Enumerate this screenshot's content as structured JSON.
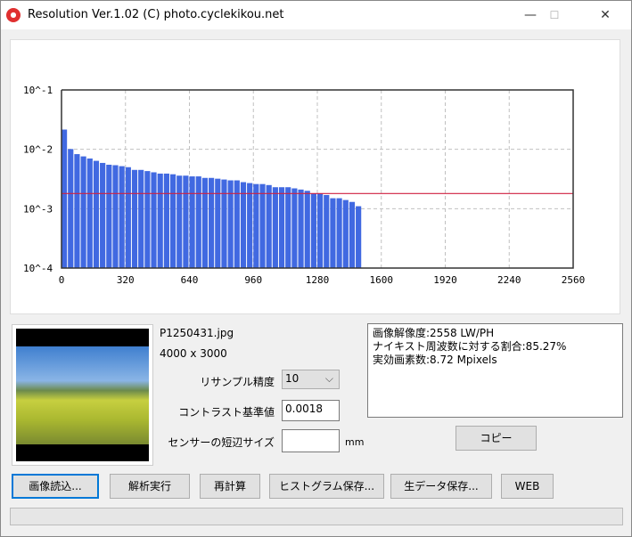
{
  "window": {
    "title": "Resolution Ver.1.02 (C) photo.cyclekikou.net",
    "app_icon": "camera-icon",
    "minimize": "—",
    "maximize": "☐",
    "close": "✕"
  },
  "file": {
    "name": "P1250431.jpg",
    "dimensions": "4000 x 3000"
  },
  "form": {
    "resample_label": "リサンプル精度",
    "resample_value": "10",
    "contrast_label": "コントラスト基準値",
    "contrast_value": "0.0018",
    "sensor_label": "センサーの短辺サイズ",
    "sensor_value": "",
    "sensor_unit": "mm"
  },
  "result": {
    "lines": [
      "画像解像度:2558 LW/PH",
      "ナイキスト周波数に対する割合:85.27%",
      "実効画素数:8.72 Mpixels"
    ]
  },
  "copy_button": "コピー",
  "buttons": [
    "画像読込...",
    "解析実行",
    "再計算",
    "ヒストグラム保存...",
    "生データ保存...",
    "WEB"
  ],
  "progress": 0,
  "chart_data": {
    "type": "bar",
    "y_scale": "log",
    "ylim": [
      0.0001,
      0.1
    ],
    "xlim": [
      0,
      2560
    ],
    "y_tick_labels": [
      "10^-1",
      "10^-2",
      "10^-3",
      "10^-4"
    ],
    "x_tick_labels": [
      "0",
      "320",
      "640",
      "960",
      "1280",
      "1600",
      "1920",
      "2240",
      "2560"
    ],
    "bar_width": 32,
    "x": [
      0,
      32,
      64,
      96,
      128,
      160,
      192,
      224,
      256,
      288,
      320,
      352,
      384,
      416,
      448,
      480,
      512,
      544,
      576,
      608,
      640,
      672,
      704,
      736,
      768,
      800,
      832,
      864,
      896,
      928,
      960,
      992,
      1024,
      1056,
      1088,
      1120,
      1152,
      1184,
      1216,
      1248,
      1280,
      1312,
      1344,
      1376,
      1408,
      1440,
      1472
    ],
    "values": [
      0.0215,
      0.0101,
      0.0083,
      0.0076,
      0.007,
      0.0064,
      0.0059,
      0.0055,
      0.0054,
      0.0052,
      0.005,
      0.0045,
      0.0045,
      0.0043,
      0.0041,
      0.0039,
      0.0039,
      0.0038,
      0.0036,
      0.0036,
      0.0035,
      0.0035,
      0.0033,
      0.0033,
      0.0032,
      0.0031,
      0.003,
      0.003,
      0.0028,
      0.0027,
      0.0026,
      0.0026,
      0.0025,
      0.0023,
      0.0023,
      0.0023,
      0.0022,
      0.0021,
      0.002,
      0.0018,
      0.0018,
      0.0017,
      0.0015,
      0.0015,
      0.0014,
      0.0013,
      0.0011
    ],
    "threshold": 0.0018,
    "colors": {
      "bar": "#4169e1",
      "threshold": "#d02040",
      "grid": "#c0c0c0"
    },
    "grid": true
  }
}
